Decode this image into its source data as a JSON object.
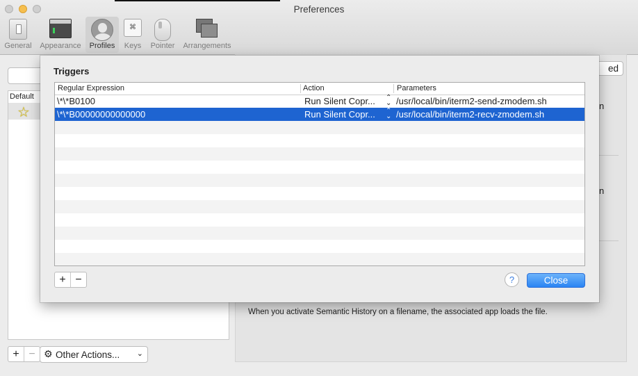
{
  "window": {
    "title": "Preferences"
  },
  "toolbar": {
    "items": [
      {
        "label": "General",
        "icon": "general-icon",
        "selected": false
      },
      {
        "label": "Appearance",
        "icon": "appearance-icon",
        "selected": false
      },
      {
        "label": "Profiles",
        "icon": "profiles-icon",
        "selected": true
      },
      {
        "label": "Keys",
        "icon": "keys-icon",
        "selected": false
      },
      {
        "label": "Pointer",
        "icon": "pointer-icon",
        "selected": false
      },
      {
        "label": "Arrangements",
        "icon": "arrangements-icon",
        "selected": false
      }
    ],
    "keys_glyph": "⌘"
  },
  "profiles": {
    "column_header": "Default",
    "default_marker": "☆",
    "add_glyph": "+",
    "remove_glyph": "−",
    "other_actions_label": "Other Actions...",
    "gear_glyph": "⚙",
    "chevron_glyph": "⌄"
  },
  "background": {
    "advanced_tab_fragment": "ed",
    "fragment_1": "n",
    "fragment_2": "n",
    "semantic_history_text": "When you activate Semantic History on a filename, the associated app loads the file."
  },
  "triggers_sheet": {
    "title": "Triggers",
    "columns": [
      "Regular Expression",
      "Action",
      "Parameters"
    ],
    "rows": [
      {
        "regex": "\\*\\*B0100",
        "action": "Run Silent Copr...",
        "parameters": "/usr/local/bin/iterm2-send-zmodem.sh",
        "selected": false
      },
      {
        "regex": "\\*\\*B00000000000000",
        "action": "Run Silent Copr...",
        "parameters": "/usr/local/bin/iterm2-recv-zmodem.sh",
        "selected": true
      }
    ],
    "stepper_glyph": "⌃⌄",
    "add_glyph": "+",
    "remove_glyph": "−",
    "help_glyph": "?",
    "close_label": "Close"
  },
  "colors": {
    "selection": "#1e64d1",
    "close_button": "#2a84f3",
    "favorite_star": "#e7cf35"
  }
}
